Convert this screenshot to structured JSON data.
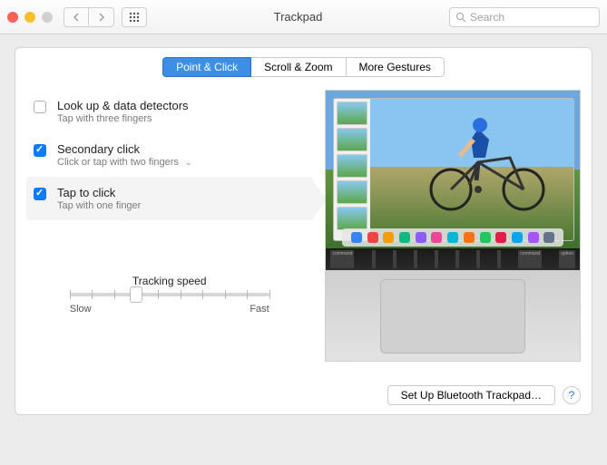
{
  "window": {
    "title": "Trackpad"
  },
  "search": {
    "placeholder": "Search"
  },
  "tabs": [
    {
      "label": "Point & Click",
      "active": true
    },
    {
      "label": "Scroll & Zoom",
      "active": false
    },
    {
      "label": "More Gestures",
      "active": false
    }
  ],
  "options": {
    "lookup": {
      "checked": false,
      "title": "Look up & data detectors",
      "sub": "Tap with three fingers"
    },
    "secondary": {
      "checked": true,
      "title": "Secondary click",
      "sub": "Click or tap with two fingers"
    },
    "tap": {
      "checked": true,
      "title": "Tap to click",
      "sub": "Tap with one finger"
    }
  },
  "slider": {
    "label": "Tracking speed",
    "min_label": "Slow",
    "max_label": "Fast",
    "value": 3,
    "ticks": 10
  },
  "footer": {
    "bluetooth": "Set Up Bluetooth Trackpad…",
    "help": "?"
  },
  "preview": {
    "keys": [
      "command",
      "",
      "",
      "",
      "",
      "",
      "",
      "",
      "command",
      "option"
    ]
  },
  "colors": {
    "accent": "#3c8fe5",
    "dock": [
      "#3b82f6",
      "#ef4444",
      "#f59e0b",
      "#10b981",
      "#8b5cf6",
      "#ec4899",
      "#06b6d4",
      "#f97316",
      "#22c55e",
      "#e11d48",
      "#0ea5e9",
      "#a855f7",
      "#64748b"
    ]
  }
}
